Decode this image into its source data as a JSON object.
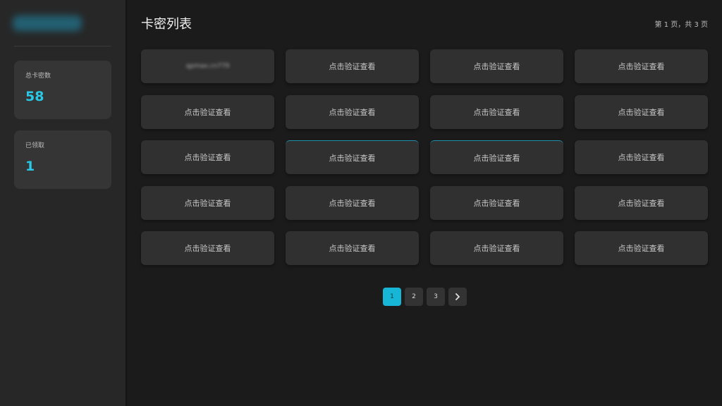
{
  "sidebar": {
    "stats": [
      {
        "label": "总卡密数",
        "value": "58"
      },
      {
        "label": "已领取",
        "value": "1"
      }
    ]
  },
  "main": {
    "title": "卡密列表",
    "page_info": "第 1 页，共 3 页",
    "cards": [
      {
        "text": "qpmax.cn779",
        "state": "revealed"
      },
      {
        "text": "点击验证查看",
        "state": "normal"
      },
      {
        "text": "点击验证查看",
        "state": "normal"
      },
      {
        "text": "点击验证查看",
        "state": "normal"
      },
      {
        "text": "点击验证查看",
        "state": "normal"
      },
      {
        "text": "点击验证查看",
        "state": "normal"
      },
      {
        "text": "点击验证查看",
        "state": "normal"
      },
      {
        "text": "点击验证查看",
        "state": "normal"
      },
      {
        "text": "点击验证查看",
        "state": "normal"
      },
      {
        "text": "点击验证查看",
        "state": "highlight"
      },
      {
        "text": "点击验证查看",
        "state": "highlight"
      },
      {
        "text": "点击验证查看",
        "state": "normal"
      },
      {
        "text": "点击验证查看",
        "state": "normal"
      },
      {
        "text": "点击验证查看",
        "state": "normal"
      },
      {
        "text": "点击验证查看",
        "state": "normal"
      },
      {
        "text": "点击验证查看",
        "state": "normal"
      },
      {
        "text": "点击验证查看",
        "state": "normal"
      },
      {
        "text": "点击验证查看",
        "state": "normal"
      },
      {
        "text": "点击验证查看",
        "state": "normal"
      },
      {
        "text": "点击验证查看",
        "state": "normal"
      }
    ]
  },
  "pagination": {
    "pages": [
      "1",
      "2",
      "3"
    ],
    "current": "1",
    "next_icon": "chevron-right-icon"
  },
  "colors": {
    "accent": "#18b6d6",
    "stat_value": "#28c8e6",
    "background": "#1b1b1b",
    "sidebar": "#272727",
    "card": "#303030"
  }
}
